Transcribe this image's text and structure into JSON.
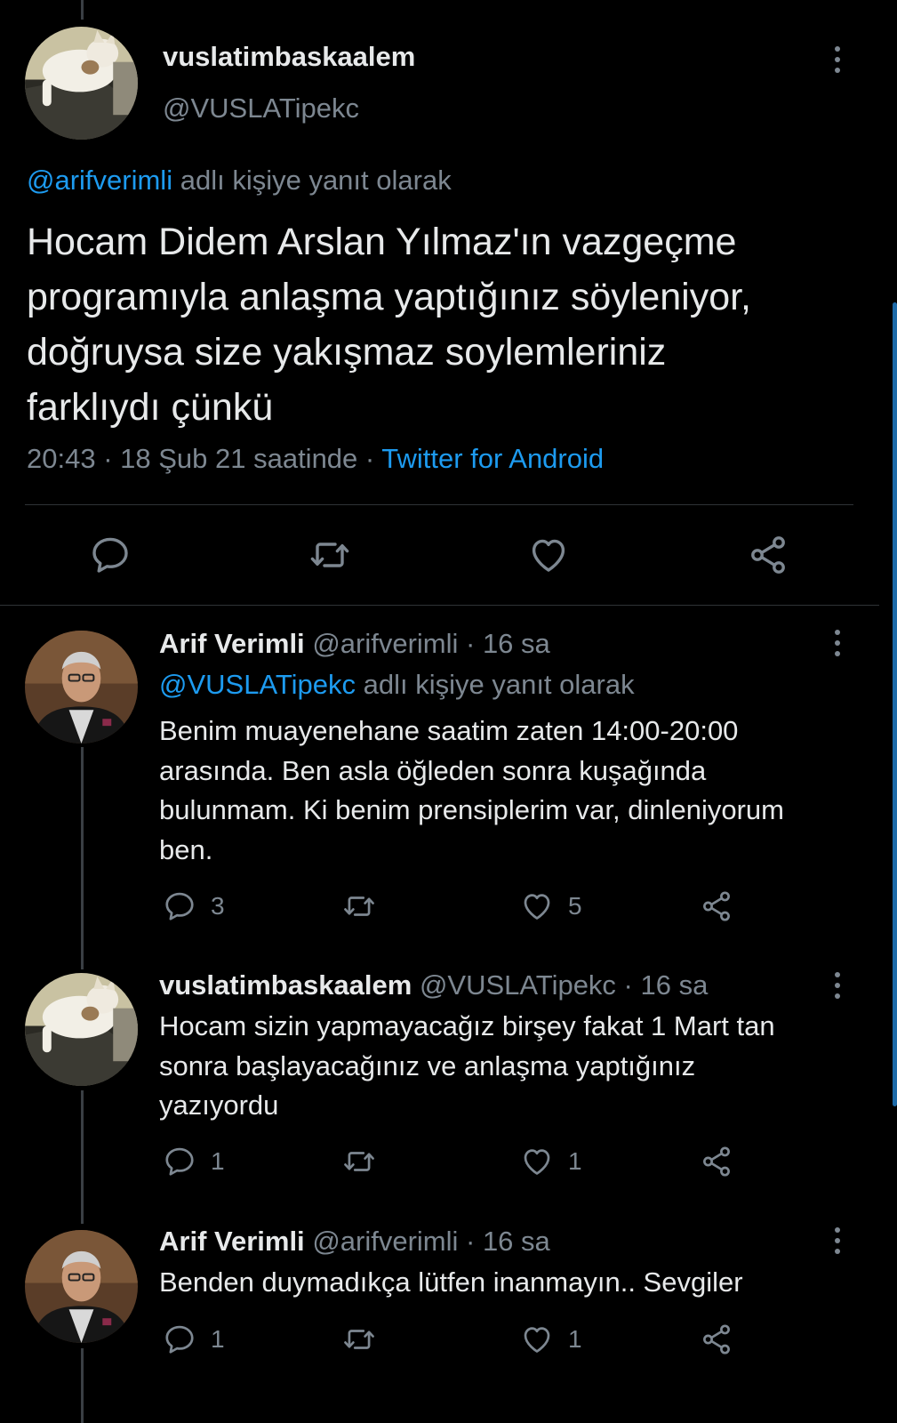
{
  "main_tweet": {
    "display_name": "vuslatimbaskaalem",
    "handle": "@VUSLATipekc",
    "reply_to_handle": "@arifverimli",
    "reply_to_suffix": "adlı kişiye yanıt olarak",
    "text_lines": [
      "Hocam Didem Arslan Yılmaz'ın vazgeçme",
      "programıyla anlaşma yaptığınız söyleniyor,",
      "doğruysa size yakışmaz soylemleriniz",
      "farklıydı çünkü"
    ],
    "timestamp": "20:43 · 18 Şub 21 saatinde · ",
    "source": "Twitter for Android"
  },
  "replies": [
    {
      "display_name": "Arif Verimli",
      "meta": "@arifverimli · 16 sa",
      "reply_to_handle": "@VUSLATipekc",
      "reply_to_suffix": "adlı kişiye yanıt olarak",
      "text_lines": [
        "Benim muayenehane saatim zaten 14:00-20:00",
        "arasında. Ben asla öğleden sonra kuşağında",
        "bulunmam. Ki benim prensiplerim var, dinleniyorum",
        "ben."
      ],
      "reply_count": "3",
      "like_count": "5"
    },
    {
      "display_name": "vuslatimbaskaalem",
      "meta": "@VUSLATipekc · 16 sa",
      "text_lines": [
        "Hocam sizin yapmayacağız birşey fakat 1 Mart tan",
        "sonra başlayacağınız ve anlaşma yaptığınız",
        "yazıyordu"
      ],
      "reply_count": "1",
      "like_count": "1"
    },
    {
      "display_name": "Arif Verimli",
      "meta": "@arifverimli · 16 sa",
      "text_lines": [
        "Benden duymadıkça lütfen inanmayın.. Sevgiler"
      ],
      "reply_count": "1",
      "like_count": "1"
    }
  ],
  "icons": {
    "reply": "reply-icon",
    "retweet": "retweet-icon",
    "like": "heart-icon",
    "share": "share-icon",
    "more": "more-vertical-icon"
  },
  "colors": {
    "background": "#000000",
    "text": "#e7e9ea",
    "muted": "#7d8791",
    "accent": "#1d9bf0"
  }
}
